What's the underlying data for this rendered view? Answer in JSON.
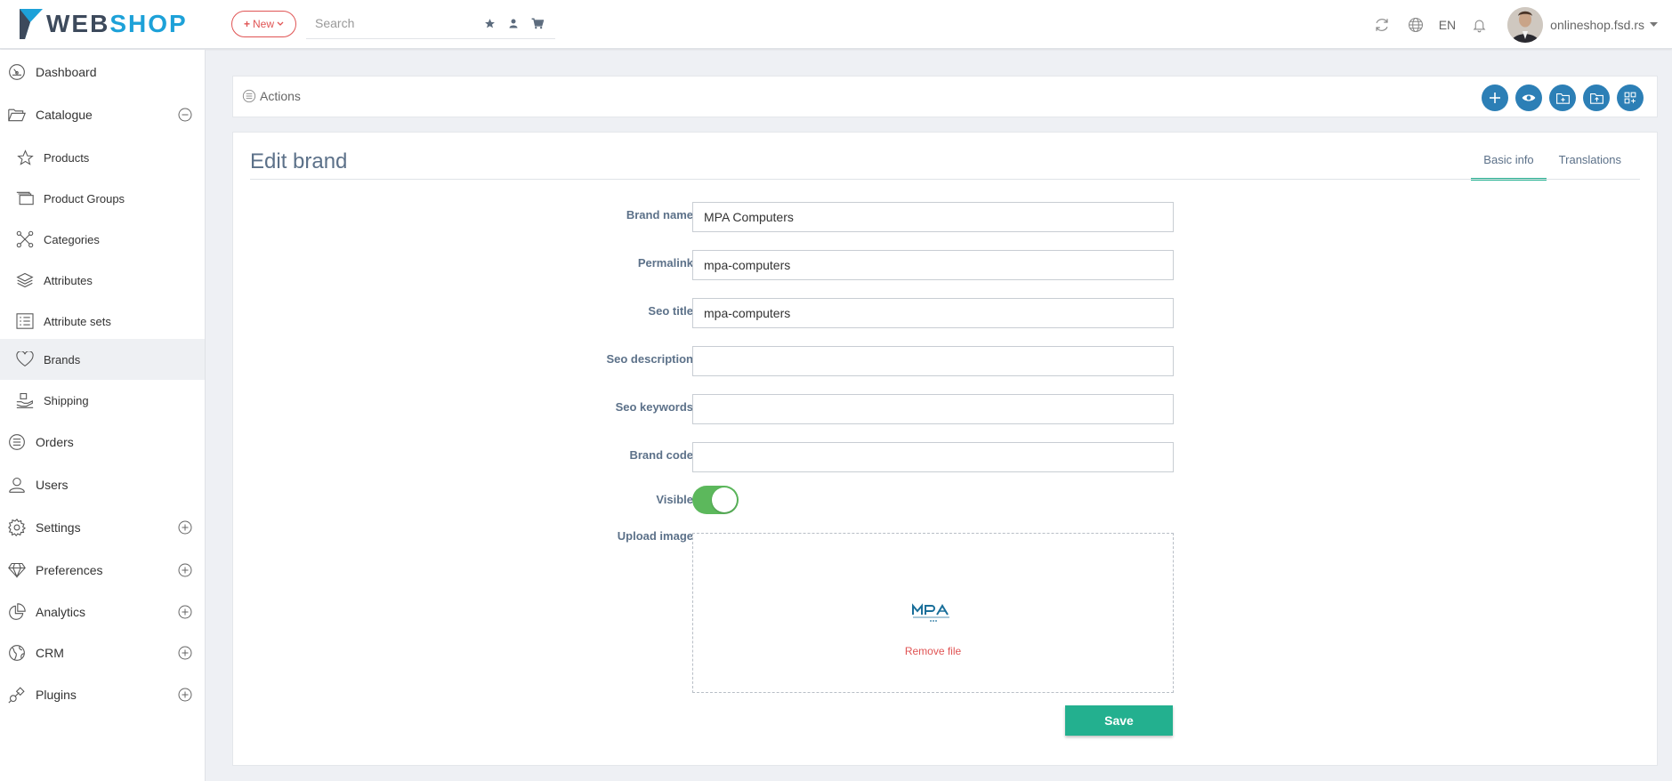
{
  "brand": {
    "logo_part1": "WEB",
    "logo_part2": "SHOP"
  },
  "topbar": {
    "new_label": "New",
    "search_placeholder": "Search",
    "language": "EN",
    "user_name": "onlineshop.fsd.rs"
  },
  "sidebar": {
    "dashboard": "Dashboard",
    "catalogue": "Catalogue",
    "products": "Products",
    "product_groups": "Product Groups",
    "categories": "Categories",
    "attributes": "Attributes",
    "attribute_sets": "Attribute sets",
    "brands": "Brands",
    "shipping": "Shipping",
    "orders": "Orders",
    "users": "Users",
    "settings": "Settings",
    "preferences": "Preferences",
    "analytics": "Analytics",
    "crm": "CRM",
    "plugins": "Plugins"
  },
  "actions": {
    "label": "Actions"
  },
  "page": {
    "title": "Edit brand",
    "tab_basic": "Basic info",
    "tab_translations": "Translations"
  },
  "form": {
    "brand_name_label": "Brand name",
    "brand_name_value": "MPA Computers",
    "permalink_label": "Permalink",
    "permalink_value": "mpa-computers",
    "seo_title_label": "Seo title",
    "seo_title_value": "mpa-computers",
    "seo_description_label": "Seo description",
    "seo_description_value": "",
    "seo_keywords_label": "Seo keywords",
    "seo_keywords_value": "",
    "brand_code_label": "Brand code",
    "brand_code_value": "",
    "visible_label": "Visible",
    "visible_on": true,
    "upload_label": "Upload image",
    "remove_file": "Remove file",
    "save_label": "Save"
  },
  "colors": {
    "accent_blue": "#2c7fb6",
    "accent_green": "#23b08f",
    "danger_red": "#e05454",
    "logo_blue": "#1da1d8"
  }
}
